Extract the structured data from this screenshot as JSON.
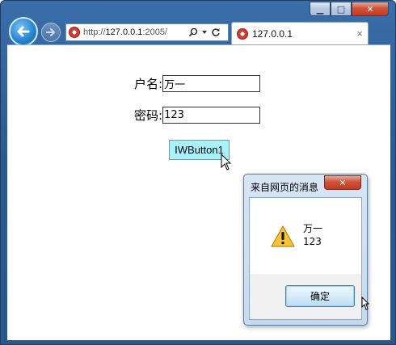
{
  "browser": {
    "address_prefix": "http://",
    "address_host": "127.0.0.1",
    "address_rest": ":2005/",
    "tab_title": "127.0.0.1",
    "tab_close": "×",
    "window_controls": {
      "minimize": "▁",
      "maximize": "□",
      "close": "✕"
    }
  },
  "form": {
    "username_label": "户名:",
    "username_value": "万一",
    "password_label": "密码:",
    "password_value": "123",
    "button_label": "IWButton1",
    "button_color": "#a9f1fb"
  },
  "dialog": {
    "title": "来自网页的消息",
    "close": "✕",
    "message_line1": "万一",
    "message_line2": "123",
    "ok_label": "确定",
    "icon": "warning-icon"
  },
  "colors": {
    "frame": "#2b5b93",
    "close_red": "#c23a1f",
    "dialog_bg": "#c6d9ee"
  }
}
